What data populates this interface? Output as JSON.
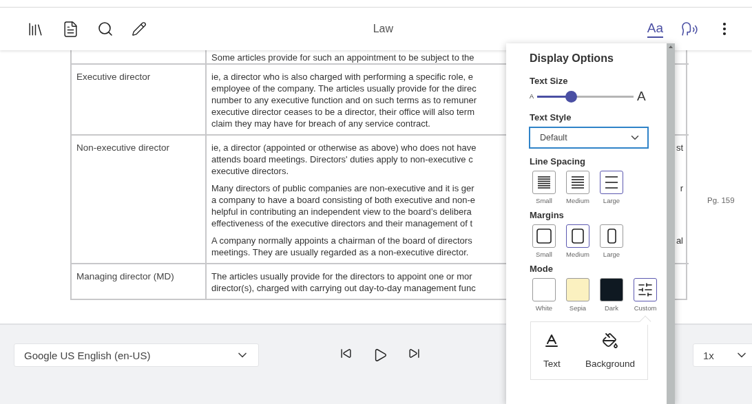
{
  "header": {
    "title": "Law",
    "display_button": {
      "label": "Aa",
      "selected": true
    }
  },
  "table": {
    "rows": [
      {
        "paragraphs": [
          {
            "lines": [
              "Some articles provide for such an appointment to be subject to the"
            ]
          }
        ]
      },
      {
        "term": "Executive director",
        "paragraphs": [
          {
            "lines": [
              "ie, a director who is also charged with performing a specific role, e",
              "employee of the company. The articles usually provide for the direc",
              "number to any executive function and on such terms as to remuner",
              "executive director ceases to be a director, their office will also term",
              "claim they may have for breach of any service contract."
            ]
          }
        ]
      },
      {
        "term": "Non-executive director",
        "paragraphs": [
          {
            "lines": [
              "ie, a director (appointed or otherwise as above) who does not have",
              "attends board meetings. Directors' duties apply to non-executive c",
              "executive directors."
            ],
            "edge": "st"
          },
          {
            "lines": [
              "Many directors of public companies are non-executive and it is ger",
              "a company to have a board consisting of both executive and non-e",
              "helpful in contributing an independent view to the board’s delibera",
              "effectiveness of the executive directors and their management of t"
            ],
            "edge": "r"
          },
          {
            "lines": [
              "A company normally appoints a chairman of the board of directors",
              "meetings. They are usually regarded as a non-executive director."
            ],
            "edge": "al"
          }
        ]
      },
      {
        "term": "Managing director (MD)",
        "paragraphs": [
          {
            "lines": [
              "The articles usually provide for the directors to appoint one or mor",
              "director(s), charged with carrying out day-to-day management func"
            ]
          }
        ]
      }
    ]
  },
  "page_number": "Pg. 159",
  "display_options": {
    "title": "Display Options",
    "text_size": {
      "label": "Text Size",
      "small_glyph": "A",
      "large_glyph": "A",
      "level": 0.35
    },
    "text_style": {
      "label": "Text Style",
      "value": "Default"
    },
    "line_spacing": {
      "label": "Line Spacing",
      "options": [
        {
          "label": "Small",
          "kind": "small",
          "selected": false
        },
        {
          "label": "Medium",
          "kind": "medium",
          "selected": false
        },
        {
          "label": "Large",
          "kind": "large",
          "selected": true
        }
      ]
    },
    "margins": {
      "label": "Margins",
      "options": [
        {
          "label": "Small",
          "kind": "small",
          "selected": false
        },
        {
          "label": "Medium",
          "kind": "medium",
          "selected": true
        },
        {
          "label": "Large",
          "kind": "large",
          "selected": false
        }
      ]
    },
    "mode": {
      "label": "Mode",
      "options": [
        {
          "label": "White",
          "kind": "swatch",
          "color": "#ffffff",
          "selected": false
        },
        {
          "label": "Sepia",
          "kind": "swatch",
          "color": "#fbf1c0",
          "selected": false
        },
        {
          "label": "Dark",
          "kind": "swatch",
          "color": "#0f1922",
          "selected": false
        },
        {
          "label": "Custom",
          "kind": "custom",
          "selected": true
        }
      ]
    },
    "custom_options": [
      {
        "label": "Text",
        "kind": "text"
      },
      {
        "label": "Background",
        "kind": "background"
      }
    ]
  },
  "player": {
    "voice": "Google US English (en-US)",
    "speed": "1x"
  }
}
